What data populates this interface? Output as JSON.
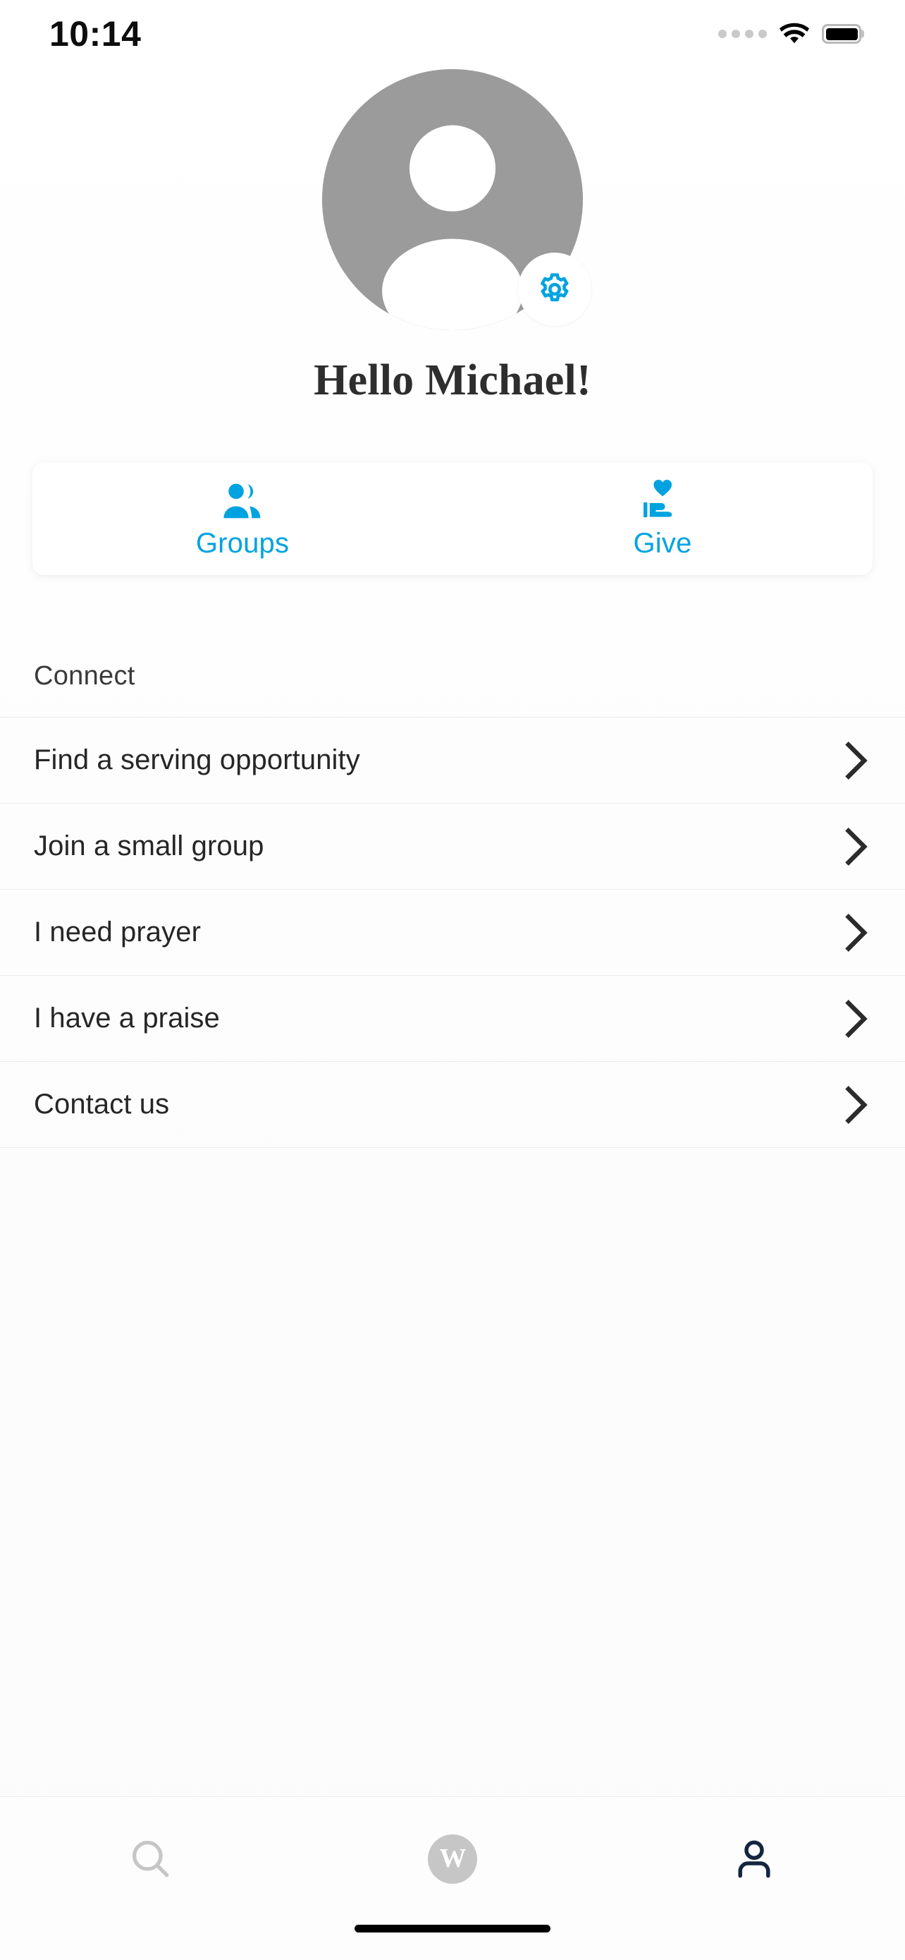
{
  "status_bar": {
    "time": "10:14",
    "cellular_icon": "cellular-dots-icon",
    "wifi_icon": "wifi-icon",
    "battery_icon": "battery-full-icon"
  },
  "header": {
    "avatar_icon": "user-avatar-placeholder-icon",
    "settings_icon": "gear-icon",
    "greeting": "Hello Michael!"
  },
  "quick_actions": {
    "items": [
      {
        "label": "Groups",
        "icon": "users-icon"
      },
      {
        "label": "Give",
        "icon": "hand-holding-heart-icon"
      }
    ]
  },
  "connect": {
    "title": "Connect",
    "items": [
      {
        "label": "Find a serving opportunity",
        "icon": "chevron-right-icon"
      },
      {
        "label": "Join a small group",
        "icon": "chevron-right-icon"
      },
      {
        "label": "I need prayer",
        "icon": "chevron-right-icon"
      },
      {
        "label": "I have a praise",
        "icon": "chevron-right-icon"
      },
      {
        "label": "Contact us",
        "icon": "chevron-right-icon"
      }
    ]
  },
  "tab_bar": {
    "items": [
      {
        "name": "search",
        "icon": "search-icon",
        "active": false
      },
      {
        "name": "home",
        "icon": "w-logo-icon",
        "logo_letter": "W",
        "active": false
      },
      {
        "name": "profile",
        "icon": "person-icon",
        "active": true
      }
    ]
  },
  "colors": {
    "accent": "#00a3e0",
    "avatar_gray": "#9b9b9b",
    "text_primary": "#262626",
    "text_heading": "#2e2e2e",
    "tab_active": "#14253f",
    "tab_inactive": "#c6c6c6",
    "divider": "#ececec",
    "background": "#fcfcfc"
  }
}
